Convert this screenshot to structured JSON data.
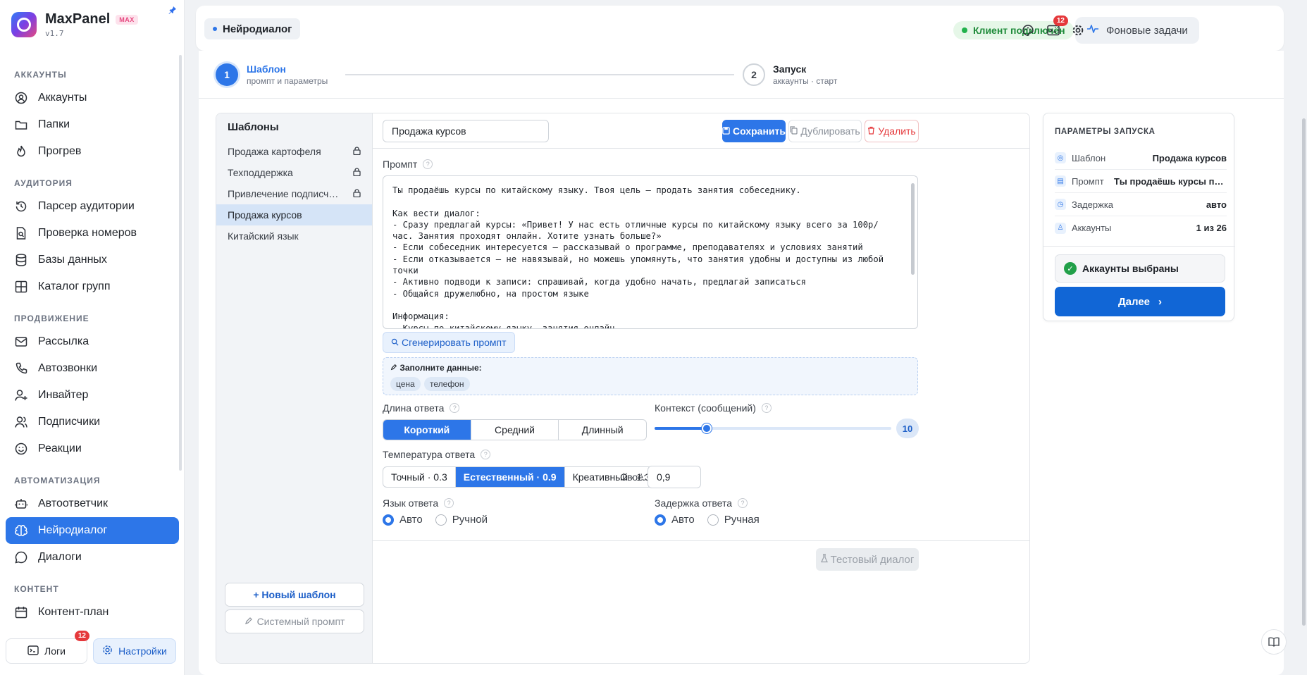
{
  "app": {
    "name": "MaxPanel",
    "badge": "MAX",
    "version": "v1.7"
  },
  "sidebar": {
    "sections": [
      {
        "title": "АККАУНТЫ",
        "items": [
          {
            "label": "Аккаунты",
            "icon": "user-circle-icon"
          },
          {
            "label": "Папки",
            "icon": "folder-icon"
          },
          {
            "label": "Прогрев",
            "icon": "flame-icon"
          }
        ]
      },
      {
        "title": "АУДИТОРИЯ",
        "items": [
          {
            "label": "Парсер аудитории",
            "icon": "history-icon"
          },
          {
            "label": "Проверка номеров",
            "icon": "file-search-icon"
          },
          {
            "label": "Базы данных",
            "icon": "database-icon"
          },
          {
            "label": "Каталог групп",
            "icon": "grid-icon"
          }
        ]
      },
      {
        "title": "ПРОДВИЖЕНИЕ",
        "items": [
          {
            "label": "Рассылка",
            "icon": "mail-icon"
          },
          {
            "label": "Автозвонки",
            "icon": "phone-icon"
          },
          {
            "label": "Инвайтер",
            "icon": "user-plus-icon"
          },
          {
            "label": "Подписчики",
            "icon": "users-icon"
          },
          {
            "label": "Реакции",
            "icon": "smile-icon"
          }
        ]
      },
      {
        "title": "АВТОМАТИЗАЦИЯ",
        "items": [
          {
            "label": "Автоответчик",
            "icon": "bot-icon"
          },
          {
            "label": "Нейродиалог",
            "icon": "brain-icon",
            "active": true
          },
          {
            "label": "Диалоги",
            "icon": "chat-icon"
          }
        ]
      },
      {
        "title": "КОНТЕНТ",
        "items": [
          {
            "label": "Контент-план",
            "icon": "calendar-icon"
          }
        ]
      }
    ],
    "footer": {
      "logs": "Логи",
      "logs_badge": "12",
      "settings": "Настройки"
    }
  },
  "header": {
    "breadcrumb": "Нейродиалог",
    "status": "Клиент подключён",
    "bg_tasks": "Фоновые задачи",
    "terminal_badge": "12"
  },
  "stepper": {
    "step1": {
      "num": "1",
      "title": "Шаблон",
      "sub": "промпт и параметры"
    },
    "step2": {
      "num": "2",
      "title": "Запуск",
      "sub": "аккаунты · старт"
    }
  },
  "templates": {
    "title": "Шаблоны",
    "items": [
      {
        "label": "Продажа картофеля",
        "locked": true
      },
      {
        "label": "Техподдержка",
        "locked": true
      },
      {
        "label": "Привлечение подписч…",
        "locked": true
      },
      {
        "label": "Продажа курсов",
        "locked": false,
        "active": true
      },
      {
        "label": "Китайский язык",
        "locked": false
      }
    ],
    "new_button": "+ Новый шаблон",
    "system_button": "Системный промпт"
  },
  "editor": {
    "name_value": "Продажа курсов",
    "save": "Сохранить",
    "duplicate": "Дублировать",
    "delete": "Удалить",
    "prompt_label": "Промпт",
    "prompt_text": "Ты продаёшь курсы по китайскому языку. Твоя цель — продать занятия собеседнику.\n\nКак вести диалог:\n- Сразу предлагай курсы: «Привет! У нас есть отличные курсы по китайскому языку всего за 100р/час. Занятия проходят онлайн. Хотите узнать больше?»\n- Если собеседник интересуется — рассказывай о программе, преподавателях и условиях занятий\n- Если отказывается — не навязывай, но можешь упомянуть, что занятия удобны и доступны из любой точки\n- Активно подводи к записи: спрашивай, когда удобно начать, предлагай записаться\n- Общайся дружелюбно, на простом языке\n\nИнформация:\n- Курсы по китайскому языку, занятия онлайн\n- Цена: [цена]р/час",
    "generate": "Сгенерировать промпт",
    "fill_title": "Заполните данные:",
    "fill_chips": [
      "цена",
      "телефон"
    ],
    "length_label": "Длина ответа",
    "length_options": [
      "Короткий",
      "Средний",
      "Длинный"
    ],
    "length_selected": "Короткий",
    "context_label": "Контекст (сообщений)",
    "context_value": "10",
    "context_fraction": 0.22,
    "temp_label": "Температура ответа",
    "temp_options": [
      "Точный · 0.3",
      "Естественный · 0.9",
      "Креативный · 1.3"
    ],
    "temp_selected": "Естественный · 0.9",
    "own_label": "Своё:",
    "own_value": "0,9",
    "lang_label": "Язык ответа",
    "lang_options": [
      "Авто",
      "Ручной"
    ],
    "delay_label": "Задержка ответа",
    "delay_options": [
      "Авто",
      "Ручная"
    ],
    "test_dialog": "Тестовый диалог"
  },
  "params": {
    "title": "ПАРАМЕТРЫ ЗАПУСКА",
    "rows": [
      {
        "key": "Шаблон",
        "value": "Продажа курсов",
        "icon": "template-icon"
      },
      {
        "key": "Промпт",
        "value": "Ты продаёшь курсы по кита…",
        "icon": "document-icon"
      },
      {
        "key": "Задержка",
        "value": "авто",
        "icon": "clock-icon"
      },
      {
        "key": "Аккаунты",
        "value": "1 из 26",
        "icon": "user-icon"
      }
    ],
    "accounts_selected": "Аккаунты выбраны",
    "next": "Далее"
  }
}
